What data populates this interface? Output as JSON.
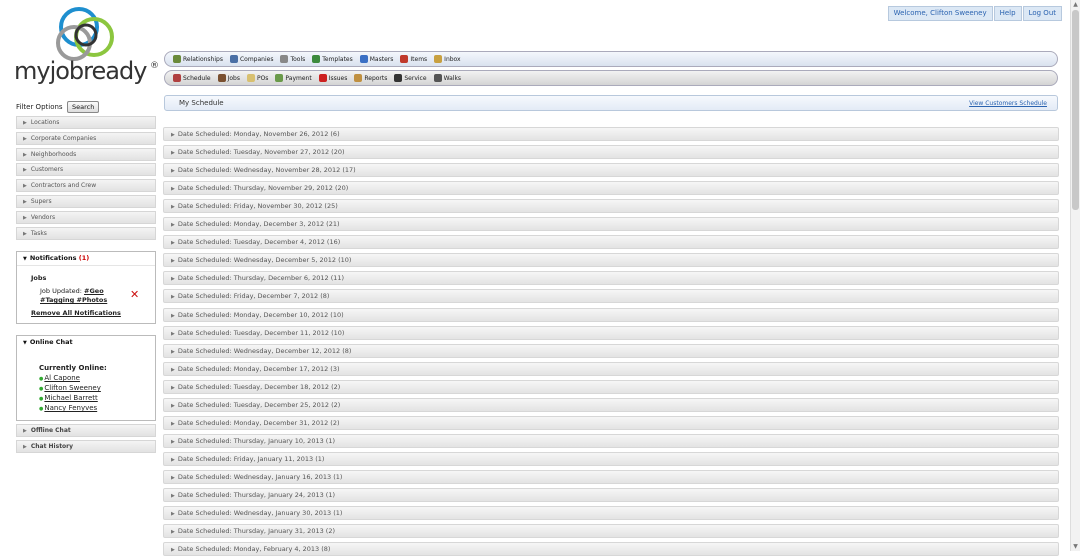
{
  "header": {
    "welcome": "Welcome, Clifton Sweeney",
    "help": "Help",
    "logout": "Log Out"
  },
  "logo": {
    "text": "myjobready",
    "registered": "®"
  },
  "nav_primary": [
    {
      "label": "Relationships",
      "icon": "relationships-icon",
      "color": "#6a8a3a"
    },
    {
      "label": "Companies",
      "icon": "companies-icon",
      "color": "#4a6fa5"
    },
    {
      "label": "Tools",
      "icon": "tools-icon",
      "color": "#888888"
    },
    {
      "label": "Templates",
      "icon": "templates-icon",
      "color": "#3c8a3c"
    },
    {
      "label": "Masters",
      "icon": "masters-icon",
      "color": "#3a6fc4"
    },
    {
      "label": "Items",
      "icon": "items-icon",
      "color": "#c0392b"
    },
    {
      "label": "Inbox",
      "icon": "inbox-icon",
      "color": "#c8a040"
    }
  ],
  "nav_secondary": [
    {
      "label": "Schedule",
      "icon": "schedule-icon",
      "color": "#b04040"
    },
    {
      "label": "Jobs",
      "icon": "jobs-icon",
      "color": "#7a5030"
    },
    {
      "label": "POs",
      "icon": "pos-icon",
      "color": "#d8c070"
    },
    {
      "label": "Payment",
      "icon": "payment-icon",
      "color": "#6a9a4a"
    },
    {
      "label": "Issues",
      "icon": "issues-icon",
      "color": "#cc2020"
    },
    {
      "label": "Reports",
      "icon": "reports-icon",
      "color": "#c09040"
    },
    {
      "label": "Service",
      "icon": "service-icon",
      "color": "#333333"
    },
    {
      "label": "Walks",
      "icon": "walks-icon",
      "color": "#555555"
    }
  ],
  "filter": {
    "label": "Filter Options",
    "search_button": "Search",
    "items": [
      "Locations",
      "Corporate Companies",
      "Neighborhoods",
      "Customers",
      "Contractors and Crew",
      "Supers",
      "Vendors",
      "Tasks"
    ]
  },
  "notifications": {
    "title": "Notifications",
    "count": "(1)",
    "section": "Jobs",
    "item_prefix": "Job Updated: ",
    "item_tags_line1": "#Geo",
    "item_tags_line2": "#Tagging #Photos",
    "remove_all": "Remove All Notifications"
  },
  "online_chat": {
    "title": "Online Chat",
    "currently_online": "Currently Online:",
    "users": [
      "Al Capone",
      "Clifton Sweeney",
      "Michael Barrett",
      "Nancy Fenyves"
    ]
  },
  "offline_chat": "Offline Chat",
  "chat_history": "Chat History",
  "schedule": {
    "title": "My Schedule",
    "view_customers": "View Customers Schedule",
    "rows": [
      "Date Scheduled: Monday, November 26, 2012 (6)",
      "Date Scheduled: Tuesday, November 27, 2012 (20)",
      "Date Scheduled: Wednesday, November 28, 2012 (17)",
      "Date Scheduled: Thursday, November 29, 2012 (20)",
      "Date Scheduled: Friday, November 30, 2012 (25)",
      "Date Scheduled: Monday, December 3, 2012 (21)",
      "Date Scheduled: Tuesday, December 4, 2012 (16)",
      "Date Scheduled: Wednesday, December 5, 2012 (10)",
      "Date Scheduled: Thursday, December 6, 2012 (11)",
      "Date Scheduled: Friday, December 7, 2012 (8)",
      "Date Scheduled: Monday, December 10, 2012 (10)",
      "Date Scheduled: Tuesday, December 11, 2012 (10)",
      "Date Scheduled: Wednesday, December 12, 2012 (8)",
      "Date Scheduled: Monday, December 17, 2012 (3)",
      "Date Scheduled: Tuesday, December 18, 2012 (2)",
      "Date Scheduled: Tuesday, December 25, 2012 (2)",
      "Date Scheduled: Monday, December 31, 2012 (2)",
      "Date Scheduled: Thursday, January 10, 2013 (1)",
      "Date Scheduled: Friday, January 11, 2013 (1)",
      "Date Scheduled: Wednesday, January 16, 2013 (1)",
      "Date Scheduled: Thursday, January 24, 2013 (1)",
      "Date Scheduled: Wednesday, January 30, 2013 (1)",
      "Date Scheduled: Thursday, January 31, 2013 (2)",
      "Date Scheduled: Monday, February 4, 2013 (8)"
    ]
  }
}
